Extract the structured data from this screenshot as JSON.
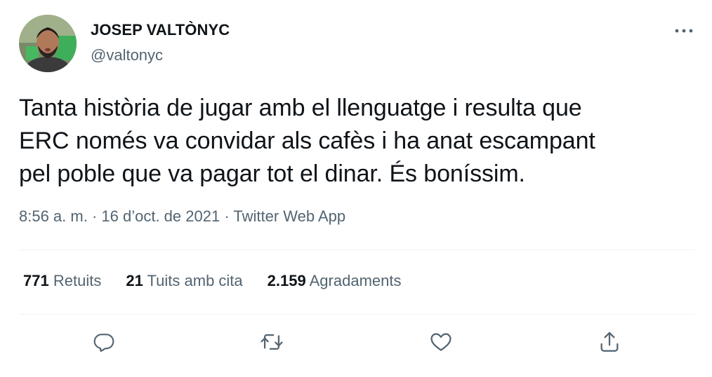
{
  "author": {
    "display_name": "JOSEP VALTÒNYC",
    "handle": "@valtonyc"
  },
  "tweet": {
    "text": "Tanta història de jugar amb el llenguatge i resulta que\nERC només va convidar als cafès i ha anat escampant\npel poble que va pagar tot el dinar. És boníssim."
  },
  "meta": {
    "time": "8:56 a. m.",
    "sep1": " · ",
    "date": "16 d’oct. de 2021",
    "sep2": " · ",
    "source": "Twitter Web App"
  },
  "stats": {
    "retweets_count": "771",
    "retweets_label": "Retuits",
    "quotes_count": "21",
    "quotes_label": "Tuits amb cita",
    "likes_count": "2.159",
    "likes_label": "Agradaments"
  },
  "icons": {
    "more": "more-horizontal-icon",
    "reply": "reply-icon",
    "retweet": "retweet-icon",
    "like": "heart-icon",
    "share": "share-icon"
  },
  "colors": {
    "text": "#0f1419",
    "secondary": "#536471",
    "divider": "#eff3f4"
  }
}
